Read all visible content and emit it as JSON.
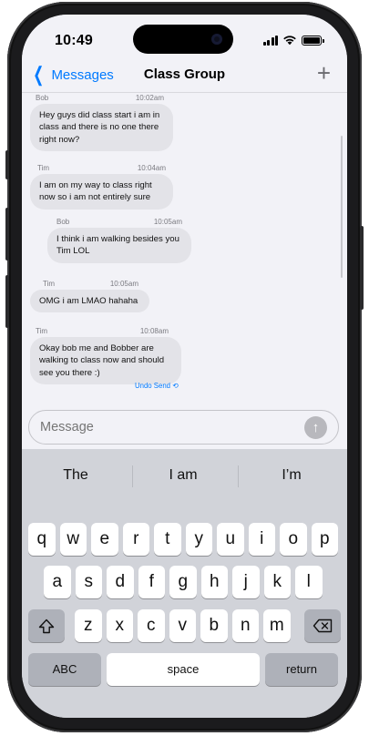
{
  "status_bar": {
    "time": "10:49"
  },
  "nav": {
    "back_label": "Messages",
    "title": "Class Group",
    "new_label": "+"
  },
  "messages": [
    {
      "sender": "Bob",
      "time": "10:02am",
      "text": "Hey guys did class start i am in class and there is no one there right now?"
    },
    {
      "sender": "Tim",
      "time": "10:04am",
      "text": "I am on my way to class right now so i am not entirely sure"
    },
    {
      "sender": "Bob",
      "time": "10:05am",
      "text": "I think i am walking besides you Tim LOL"
    },
    {
      "sender": "Tim",
      "time": "10:05am",
      "text": "OMG i am LMAO hahaha"
    },
    {
      "sender": "Tim",
      "time": "10:08am",
      "text": "Okay bob me and Bobber are walking to class now and should see you there :)"
    }
  ],
  "undo_send_label": "Undo Send",
  "composer": {
    "placeholder": "Message",
    "send_icon": "arrow-up-icon"
  },
  "keyboard": {
    "suggestions": [
      "The",
      "I am",
      "I’m"
    ],
    "row1": [
      "q",
      "w",
      "e",
      "r",
      "t",
      "y",
      "u",
      "i",
      "o",
      "p"
    ],
    "row2": [
      "a",
      "s",
      "d",
      "f",
      "g",
      "h",
      "j",
      "k",
      "l"
    ],
    "row3": [
      "z",
      "x",
      "c",
      "v",
      "b",
      "n",
      "m"
    ],
    "shift_icon": "shift-icon",
    "delete_icon": "delete-icon",
    "abc_label": "ABC",
    "space_label": "space",
    "return_label": "return"
  },
  "colors": {
    "accent": "#007aff",
    "bubble": "#e3e3e8",
    "background": "#f2f2f7",
    "keyboard": "#d1d3d9"
  }
}
